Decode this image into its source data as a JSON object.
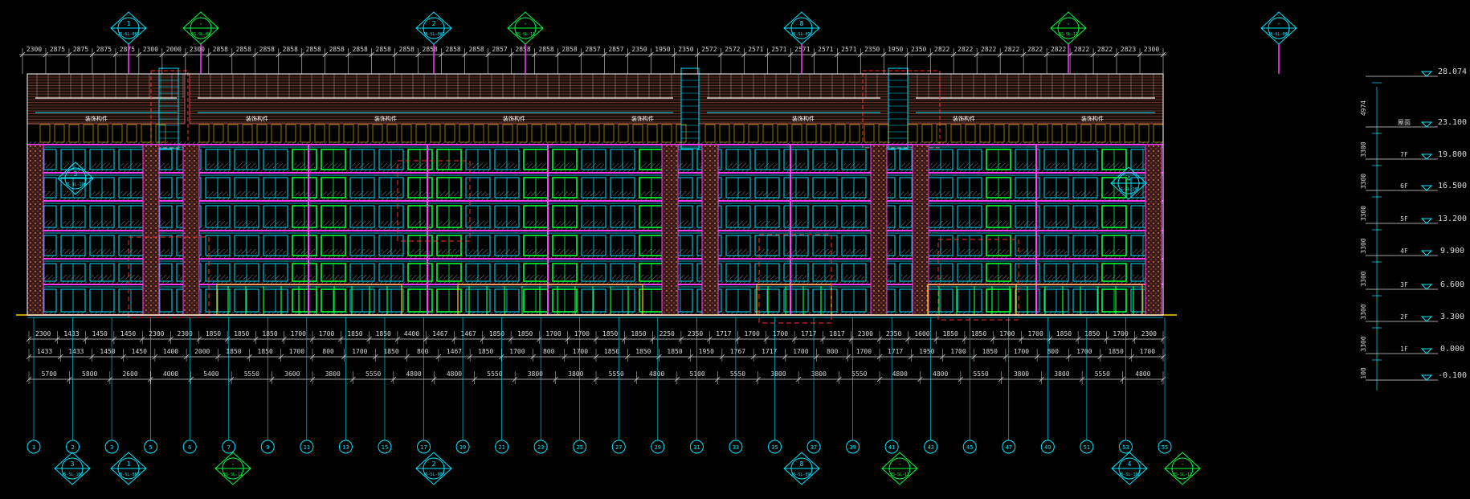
{
  "colors": {
    "background": "#000000",
    "dimension": "#d8d8d8",
    "outline": "#ffffff",
    "cyan": "#00e5ff",
    "green": "#00ff3c",
    "magenta": "#ff3cff",
    "red": "#ff3030",
    "yellow": "#ffd000",
    "roof_red": "#c06050",
    "hatch": "#8a8a8a"
  },
  "top_dims": [
    "2300",
    "2875",
    "2875",
    "2875",
    "2875",
    "2300",
    "2000",
    "2300",
    "2858",
    "2858",
    "2858",
    "2858",
    "2858",
    "2858",
    "2858",
    "2858",
    "2858",
    "2858",
    "2858",
    "2858",
    "2857",
    "2858",
    "2858",
    "2858",
    "2857",
    "2857",
    "2350",
    "1950",
    "2350",
    "2572",
    "2572",
    "2571",
    "2571",
    "2571",
    "2571",
    "2571",
    "2350",
    "1950",
    "2350",
    "2822",
    "2822",
    "2822",
    "2822",
    "2822",
    "2822",
    "2822",
    "2822",
    "2823",
    "2300"
  ],
  "bottom_dims_row1": [
    "2300",
    "1433",
    "1450",
    "1450",
    "2300",
    "2300",
    "1850",
    "1850",
    "1850",
    "1700",
    "1700",
    "1850",
    "1850",
    "4400",
    "1467",
    "1467",
    "1850",
    "1850",
    "1700",
    "1700",
    "1850",
    "1850",
    "2250",
    "2350",
    "1717",
    "1700",
    "1700",
    "1717",
    "1817",
    "2300",
    "2350",
    "1600",
    "1850",
    "1850",
    "1700",
    "1700",
    "1850",
    "1850",
    "1700",
    "2300"
  ],
  "bottom_dims_row2": [
    "1433",
    "1433",
    "1450",
    "1450",
    "1400",
    "2000",
    "1850",
    "1850",
    "1700",
    "800",
    "1700",
    "1850",
    "800",
    "1467",
    "1850",
    "1700",
    "800",
    "1700",
    "1850",
    "1850",
    "1850",
    "1950",
    "1767",
    "1717",
    "1700",
    "800",
    "1700",
    "1717",
    "1950",
    "1700",
    "1850",
    "1700",
    "800",
    "1700",
    "1850",
    "1700"
  ],
  "bottom_dims_row3": [
    "5700",
    "5800",
    "2600",
    "4000",
    "5400",
    "5550",
    "3600",
    "3800",
    "5550",
    "4800",
    "4800",
    "5550",
    "3800",
    "3800",
    "5550",
    "4800",
    "5100",
    "5550",
    "3800",
    "3800",
    "5550",
    "4800",
    "4800",
    "5550",
    "3800",
    "3800",
    "5550",
    "4800"
  ],
  "axis_numbers": [
    "1",
    "2",
    "3",
    "5",
    "6",
    "7",
    "9",
    "11",
    "13",
    "15",
    "17",
    "19",
    "21",
    "23",
    "25",
    "27",
    "29",
    "31",
    "33",
    "35",
    "37",
    "39",
    "41",
    "43",
    "45",
    "47",
    "49",
    "51",
    "53",
    "55"
  ],
  "section_top": [
    {
      "num": "1",
      "sheet": "JS-SL-087"
    },
    {
      "num": "-",
      "sheet": "JS-SL-08"
    },
    {
      "num": "2",
      "sheet": "JS-SL-087"
    },
    {
      "num": "-",
      "sheet": "JS-SL-11"
    },
    {
      "num": "8",
      "sheet": "JS-SL-096"
    },
    {
      "num": "-",
      "sheet": "JS-SL-11"
    },
    {
      "num": "-",
      "sheet": "JS-SL-085"
    }
  ],
  "section_bottom": [
    {
      "num": "3",
      "sheet": "JS-SL-102"
    },
    {
      "num": "1",
      "sheet": "JS-SL-087"
    },
    {
      "num": "-",
      "sheet": "JS-SL-11"
    },
    {
      "num": "2",
      "sheet": "JS-SL-087"
    },
    {
      "num": "8",
      "sheet": "JS-SL-096"
    },
    {
      "num": "-",
      "sheet": "JS-SL-11"
    },
    {
      "num": "4",
      "sheet": "JS-SL-102"
    },
    {
      "num": "-",
      "sheet": "JS-SL-11"
    }
  ],
  "levels": [
    {
      "floor": "",
      "elev": "28.074"
    },
    {
      "floor": "屋面",
      "elev": "23.100"
    },
    {
      "floor": "7F",
      "elev": "19.800"
    },
    {
      "floor": "6F",
      "elev": "16.500"
    },
    {
      "floor": "5F",
      "elev": "13.200"
    },
    {
      "floor": "4F",
      "elev": "9.900"
    },
    {
      "floor": "3F",
      "elev": "6.600"
    },
    {
      "floor": "2F",
      "elev": "3.300"
    },
    {
      "floor": "1F",
      "elev": "0.000"
    },
    {
      "floor": "",
      "elev": "-0.100"
    }
  ],
  "level_spacings": [
    "4974",
    "3300",
    "3300",
    "3300",
    "3300",
    "3300",
    "3300",
    "3300",
    "100"
  ],
  "roof_note": "装饰构件"
}
